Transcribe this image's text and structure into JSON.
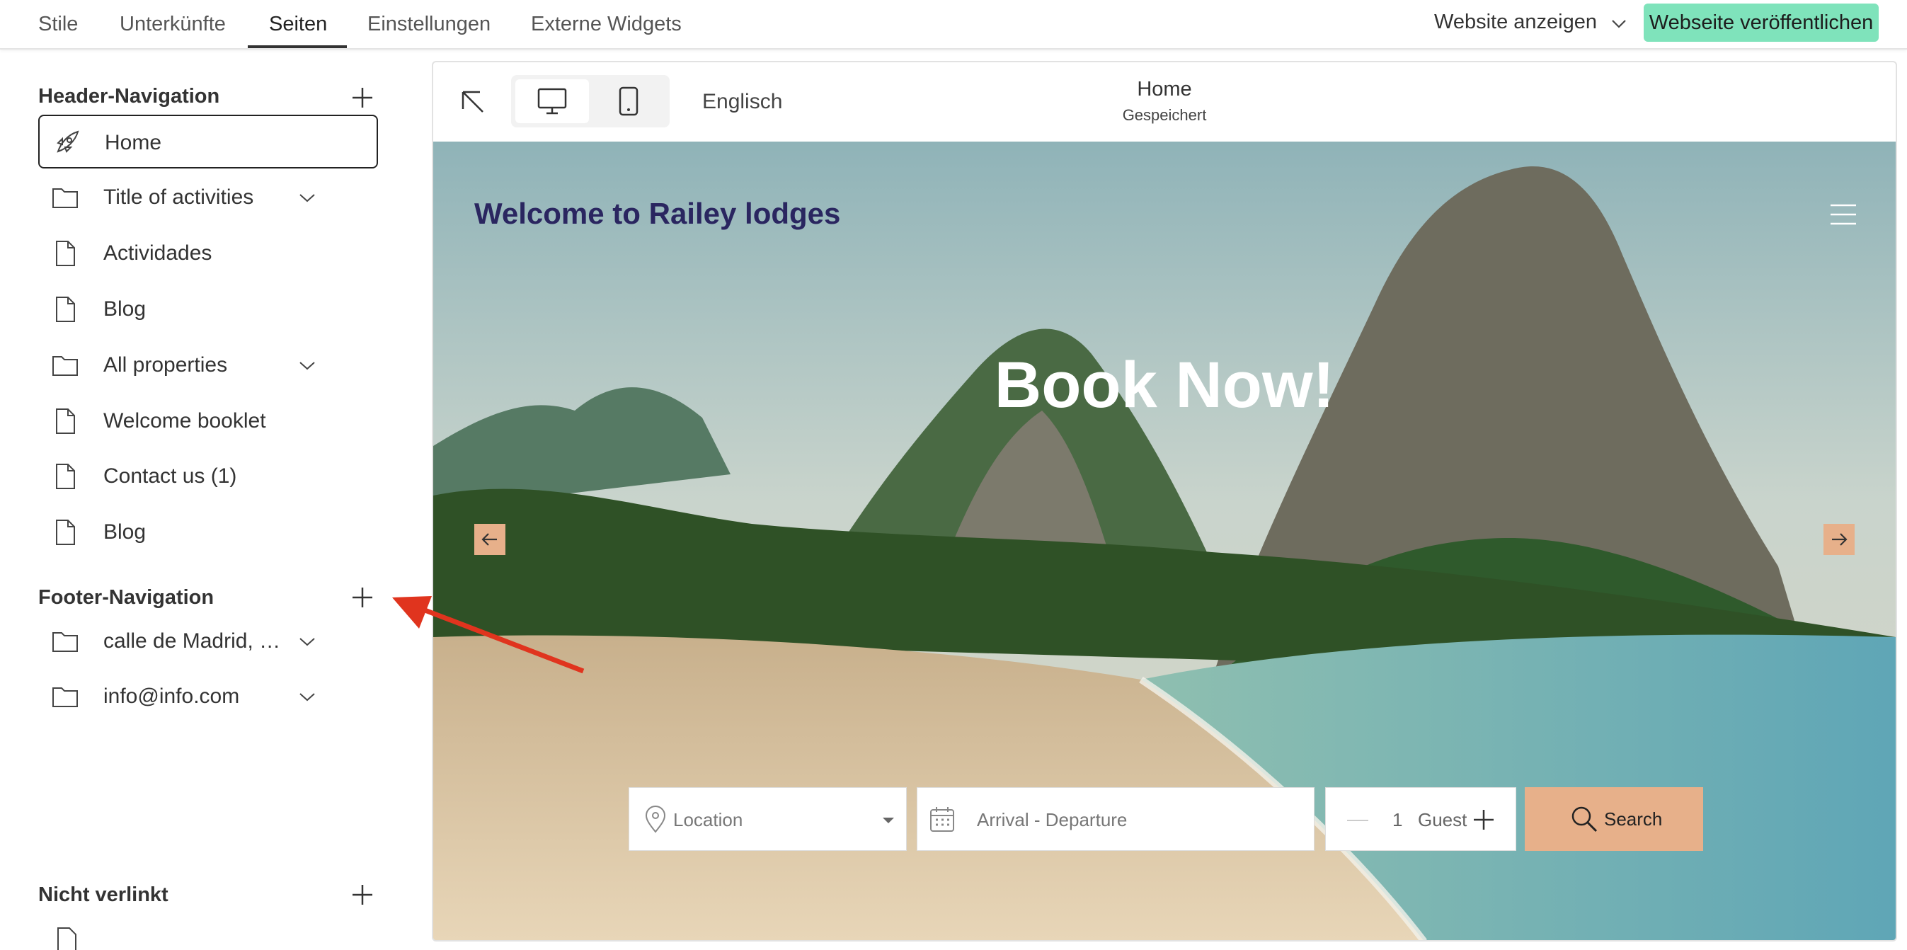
{
  "topbar": {
    "tabs": [
      {
        "label": "Stile"
      },
      {
        "label": "Unterkünfte"
      },
      {
        "label": "Seiten"
      },
      {
        "label": "Einstellungen"
      },
      {
        "label": "Externe Widgets"
      }
    ],
    "active_tab": "Seiten",
    "view_site_label": "Website anzeigen",
    "publish_label": "Webseite veröffentlichen",
    "publish_color": "#7fe3bb"
  },
  "sidebar": {
    "header_nav": {
      "title": "Header-Navigation",
      "items": [
        {
          "label": "Home",
          "icon": "rocket-icon",
          "selected": true
        },
        {
          "label": "Title of activities",
          "icon": "folder-icon",
          "expandable": true
        },
        {
          "label": "Actividades",
          "icon": "page-icon"
        },
        {
          "label": "Blog",
          "icon": "page-icon"
        },
        {
          "label": "All properties",
          "icon": "folder-icon",
          "expandable": true
        },
        {
          "label": "Welcome booklet",
          "icon": "page-icon"
        },
        {
          "label": "Contact us (1)",
          "icon": "page-icon"
        },
        {
          "label": "Blog",
          "icon": "page-icon"
        }
      ]
    },
    "footer_nav": {
      "title": "Footer-Navigation",
      "items": [
        {
          "label": "calle de Madrid, …",
          "icon": "folder-icon",
          "expandable": true
        },
        {
          "label": "info@info.com",
          "icon": "folder-icon",
          "expandable": true
        }
      ]
    },
    "unlinked": {
      "title": "Nicht verlinkt"
    }
  },
  "preview": {
    "language": "Englisch",
    "page_name": "Home",
    "page_status": "Gespeichert",
    "devices": [
      "desktop-icon",
      "mobile-icon"
    ],
    "active_device": "desktop-icon",
    "site": {
      "welcome": "Welcome to Railey lodges",
      "hero_title": "Book Now!",
      "search": {
        "location_placeholder": "Location",
        "dates_placeholder": "Arrival - Departure",
        "guest_count": "1",
        "guest_label": "Guest",
        "search_label": "Search"
      },
      "accent_color": "#e7b08a",
      "welcome_color": "#2a2660"
    }
  },
  "annotation": {
    "arrow_color": "#e0341e"
  }
}
